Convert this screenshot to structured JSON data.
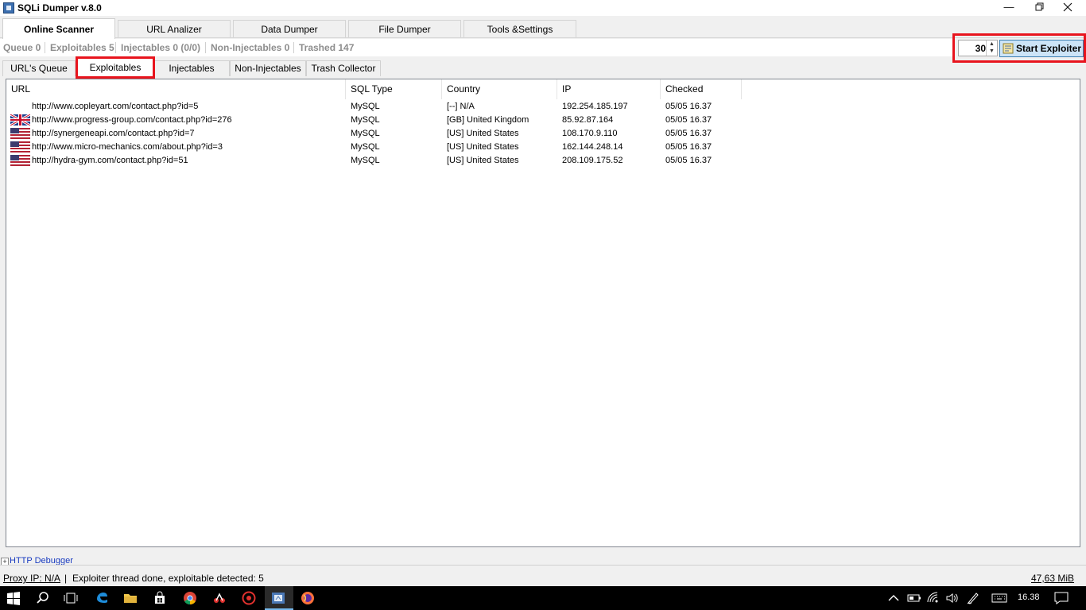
{
  "window": {
    "title": "SQLi Dumper v.8.0",
    "icons": {
      "app": "app-icon",
      "minimize": "minimize-icon",
      "maximize": "restore-icon",
      "close": "close-icon"
    }
  },
  "main_tabs": [
    {
      "label": "Online Scanner",
      "active": true
    },
    {
      "label": "URL Analizer",
      "active": false
    },
    {
      "label": "Data Dumper",
      "active": false
    },
    {
      "label": "File Dumper",
      "active": false
    },
    {
      "label": "Tools &Settings",
      "active": false
    }
  ],
  "counters": {
    "queue": "Queue 0",
    "exploitables": "Exploitables 5",
    "injectables": "Injectables 0 (0/0)",
    "non_injectables": "Non-Injectables 0",
    "trashed": "Trashed 147"
  },
  "exploiter": {
    "threads": "30",
    "start_label": "Start Exploiter",
    "highlight_color": "#e8141d"
  },
  "sub_tabs": [
    {
      "label": "URL's Queue",
      "active": false
    },
    {
      "label": "Exploitables",
      "active": true
    },
    {
      "label": "Injectables",
      "active": false
    },
    {
      "label": "Non-Injectables",
      "active": false
    },
    {
      "label": "Trash Collector",
      "active": false
    }
  ],
  "table": {
    "columns": [
      "URL",
      "SQL Type",
      "Country",
      "IP",
      "Checked"
    ],
    "rows": [
      {
        "flag": "none",
        "url": "http://www.copleyart.com/contact.php?id=5",
        "sql_type": "MySQL",
        "country": "[--] N/A",
        "ip": "192.254.185.197",
        "checked": "05/05 16.37"
      },
      {
        "flag": "gb-flag-icon",
        "url": "http://www.progress-group.com/contact.php?id=276",
        "sql_type": "MySQL",
        "country": "[GB] United Kingdom",
        "ip": "85.92.87.164",
        "checked": "05/05 16.37"
      },
      {
        "flag": "us-flag-icon",
        "url": "http://synergeneapi.com/contact.php?id=7",
        "sql_type": "MySQL",
        "country": "[US] United States",
        "ip": "108.170.9.110",
        "checked": "05/05 16.37"
      },
      {
        "flag": "us-flag-icon",
        "url": "http://www.micro-mechanics.com/about.php?id=3",
        "sql_type": "MySQL",
        "country": "[US] United States",
        "ip": "162.144.248.14",
        "checked": "05/05 16.37"
      },
      {
        "flag": "us-flag-icon",
        "url": "http://hydra-gym.com/contact.php?id=51",
        "sql_type": "MySQL",
        "country": "[US] United States",
        "ip": "208.109.175.52",
        "checked": "05/05 16.37"
      }
    ]
  },
  "debugger": {
    "label": "HTTP Debugger"
  },
  "status": {
    "proxy": "Proxy IP: N/A",
    "separator": "|",
    "message": "Exploiter thread done, exploitable detected: 5",
    "memory": "47,63 MiB"
  },
  "taskbar": {
    "icons": [
      "windows-start-icon",
      "search-icon",
      "task-view-icon",
      "edge-icon",
      "file-explorer-icon",
      "store-icon",
      "chrome-icon",
      "app-icon",
      "app-icon",
      "sqli-dumper-icon",
      "firefox-icon"
    ],
    "tray_icons": [
      "chevron-up-icon",
      "battery-icon",
      "wifi-icon",
      "volume-icon",
      "pen-icon",
      "keyboard-icon",
      "notification-icon"
    ],
    "time": "16.38"
  }
}
